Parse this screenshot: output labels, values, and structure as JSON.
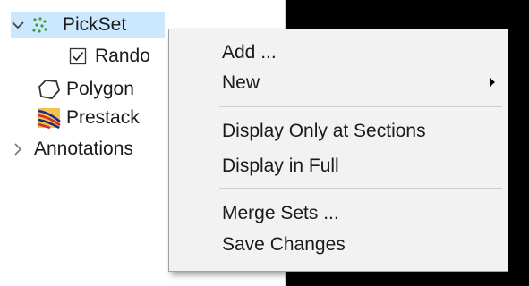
{
  "tree": {
    "items": [
      {
        "label": "PickSet",
        "icon": "pickset-icon",
        "expanded": true,
        "selected": true
      },
      {
        "label": "Rando",
        "icon": "checkbox-icon",
        "checked": true
      },
      {
        "label": "Polygon",
        "icon": "polygon-icon"
      },
      {
        "label": "Prestack",
        "icon": "prestack-icon"
      },
      {
        "label": "Annotations",
        "icon": "chevron-right-icon",
        "expanded": false
      }
    ]
  },
  "context_menu": {
    "items": [
      {
        "label": "Add ..."
      },
      {
        "label": "New",
        "has_submenu": true
      },
      {
        "label": "Display Only at Sections"
      },
      {
        "label": "Display in Full"
      },
      {
        "label": "Merge Sets ..."
      },
      {
        "label": "Save Changes"
      }
    ]
  },
  "colors": {
    "selection": "#cce8ff",
    "menu_background": "#f2f2f2",
    "viewer_background": "#000000"
  }
}
